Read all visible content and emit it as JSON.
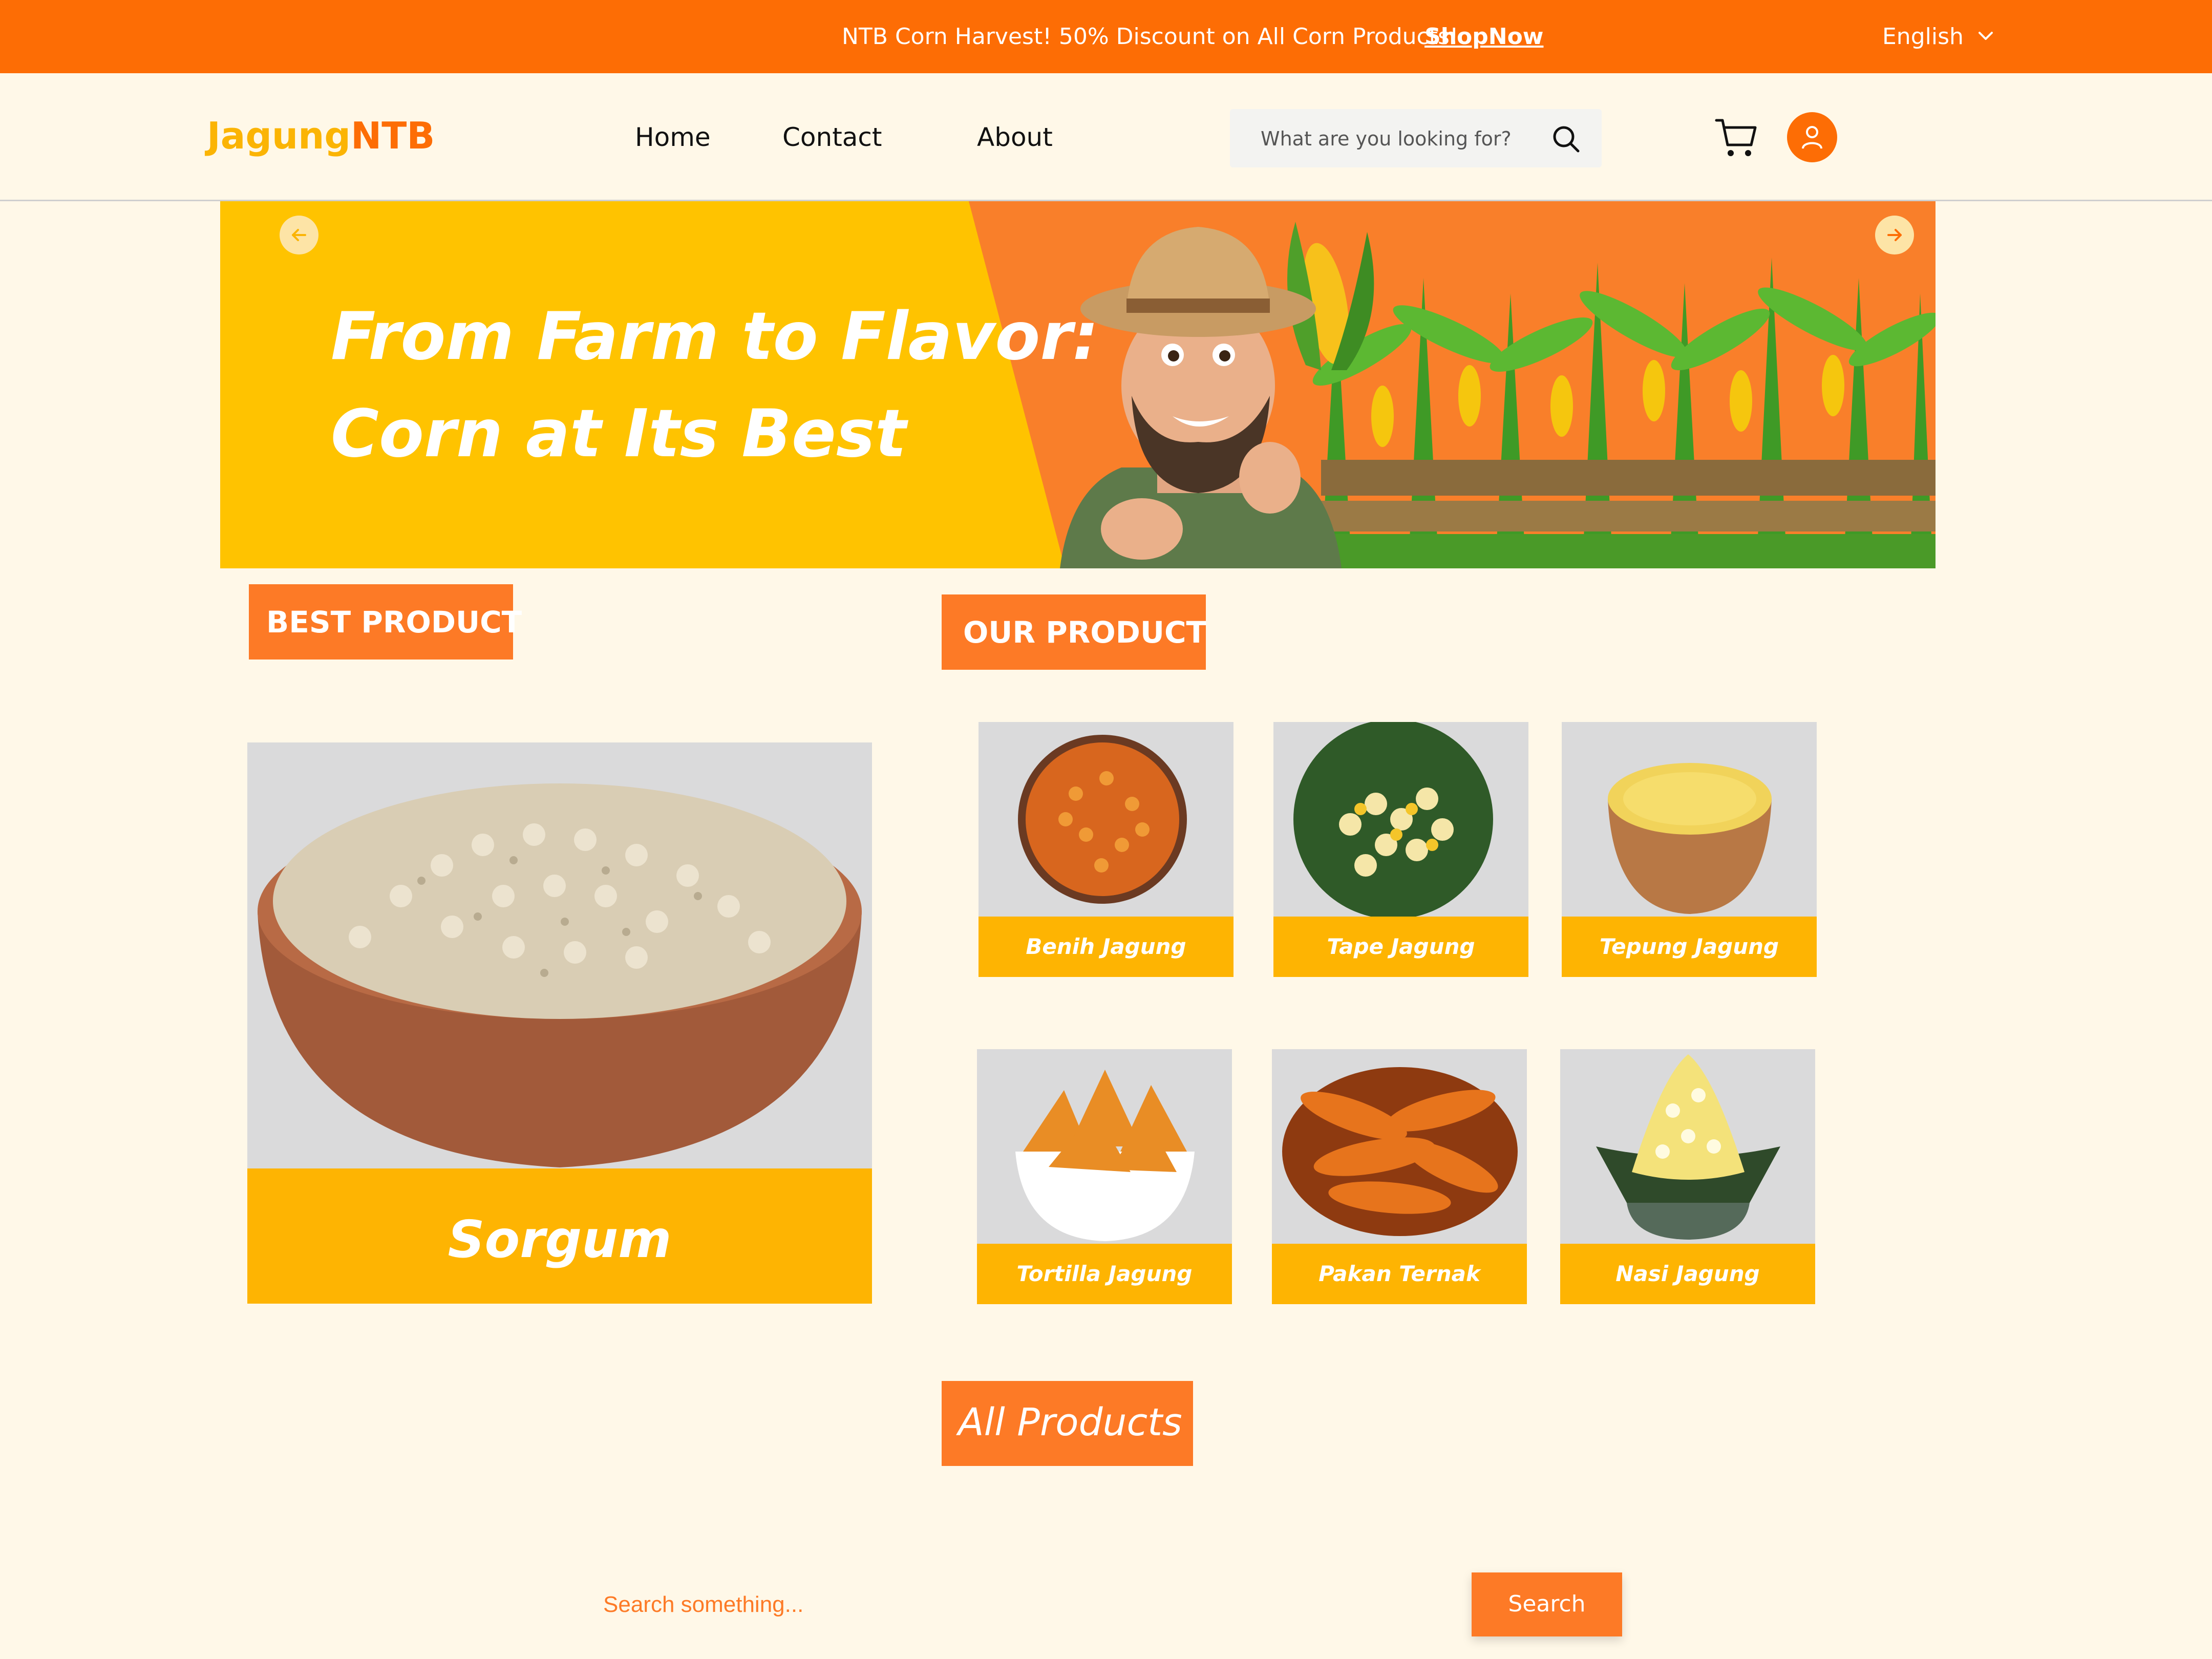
{
  "promo": {
    "text": "NTB Corn Harvest! 50% Discount on All Corn Products!",
    "link": "ShopNow",
    "language": "English"
  },
  "header": {
    "logo_part1": "Jagung",
    "logo_part2": "NTB",
    "nav": [
      "Home",
      "Contact",
      "About"
    ],
    "search_placeholder": "What are you looking for?"
  },
  "hero": {
    "line1": "From Farm to Flavor:",
    "line2": "Corn at Its Best"
  },
  "sections": {
    "best": "BEST PRODUCT",
    "our": "OUR PRODUCT",
    "all": "All Products"
  },
  "best_product": {
    "name": "Sorgum"
  },
  "products": [
    {
      "name": "Benih Jagung"
    },
    {
      "name": "Tape Jagung"
    },
    {
      "name": "Tepung Jagung"
    },
    {
      "name": "Tortilla Jagung"
    },
    {
      "name": "Pakan Ternak"
    },
    {
      "name": "Nasi Jagung"
    }
  ],
  "bottom_search": {
    "placeholder": "Search something...",
    "button": "Search"
  },
  "colors": {
    "primary_orange": "#fd6d05",
    "accent_yellow": "#feb402",
    "background": "#fff8e8"
  }
}
